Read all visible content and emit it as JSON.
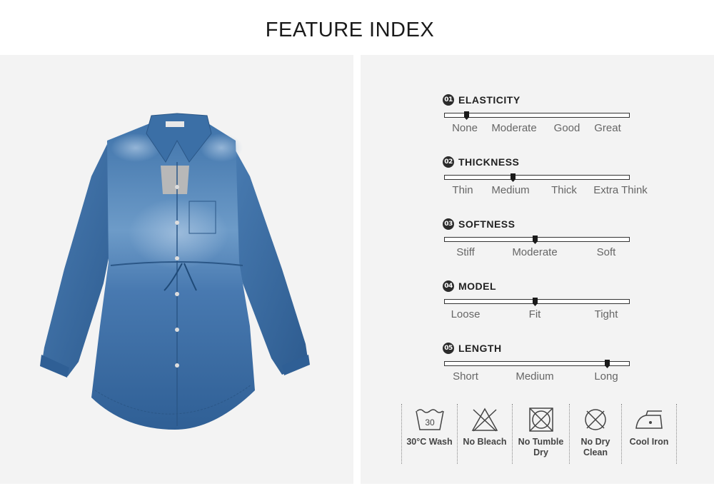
{
  "title": "FEATURE INDEX",
  "product": {
    "image": "denim-shirt-dress-photo"
  },
  "features": [
    {
      "num": "01",
      "name": "ELASTICITY",
      "options": [
        "None",
        "Moderate",
        "Good",
        "Great"
      ],
      "level": 0.12
    },
    {
      "num": "02",
      "name": "THICKNESS",
      "options": [
        "Thin",
        "Medium",
        "Thick",
        "Extra Think"
      ],
      "level": 0.37
    },
    {
      "num": "03",
      "name": "SOFTNESS",
      "options": [
        "Stiff",
        "Moderate",
        "Soft"
      ],
      "level": 0.49
    },
    {
      "num": "04",
      "name": "MODEL",
      "options": [
        "Loose",
        "Fit",
        "Tight"
      ],
      "level": 0.49
    },
    {
      "num": "05",
      "name": "LENGTH",
      "options": [
        "Short",
        "Medium",
        "Long"
      ],
      "level": 0.88
    }
  ],
  "care": [
    {
      "label": "30°C Wash",
      "icon": "wash-30-icon"
    },
    {
      "label": "No Bleach",
      "icon": "no-bleach-icon"
    },
    {
      "label": "No Tumble Dry",
      "icon": "no-tumble-dry-icon"
    },
    {
      "label": "No Dry Clean",
      "icon": "no-dry-clean-icon"
    },
    {
      "label": "Cool Iron",
      "icon": "cool-iron-icon"
    }
  ],
  "colors": {
    "accent": "#2b2b2b",
    "panel": "#f3f3f3",
    "denim": "#3d6fa3"
  }
}
